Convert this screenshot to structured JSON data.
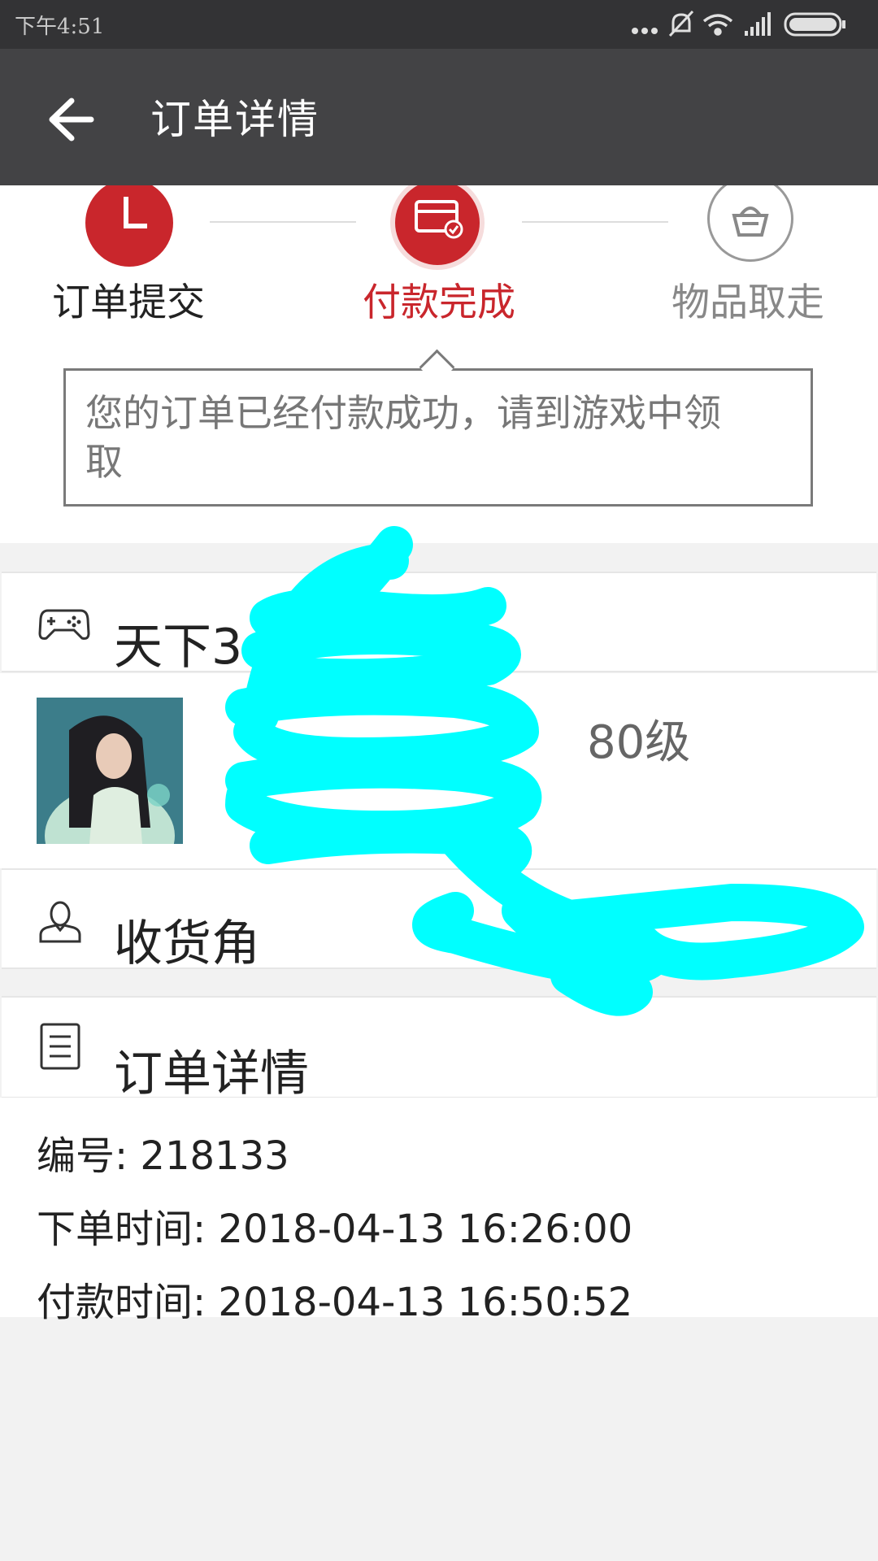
{
  "status_bar": {
    "time": "下午4:51",
    "icons": [
      "more-dots-icon",
      "mute-bell-icon",
      "wifi-icon",
      "signal-icon",
      "battery-icon"
    ]
  },
  "header": {
    "title": "订单详情",
    "back_icon": "back-arrow-icon"
  },
  "steps": [
    {
      "label": "订单提交",
      "icon": "clock-icon",
      "state": "done"
    },
    {
      "label": "付款完成",
      "icon": "card-check-icon",
      "state": "current"
    },
    {
      "label": "物品取走",
      "icon": "basket-icon",
      "state": "pending"
    }
  ],
  "tip": {
    "line1": "您的订单已经付款成功，请到游戏中领",
    "line2": "取"
  },
  "game_card": {
    "title": "天下3",
    "icon": "gamepad-icon"
  },
  "product": {
    "level": "80级"
  },
  "receiver_card": {
    "title": "收货角",
    "icon": "person-icon"
  },
  "order_card": {
    "title": "订单详情",
    "icon": "document-icon"
  },
  "order_details": {
    "number": "编号: 218133",
    "order_time": "下单时间: 2018-04-13 16:26:00",
    "pay_time": "付款时间: 2018-04-13 16:50:52"
  },
  "colors": {
    "accent_red": "#c9262c",
    "header_bg": "#434345",
    "status_bg": "#333335",
    "scribble": "#00ffff"
  }
}
